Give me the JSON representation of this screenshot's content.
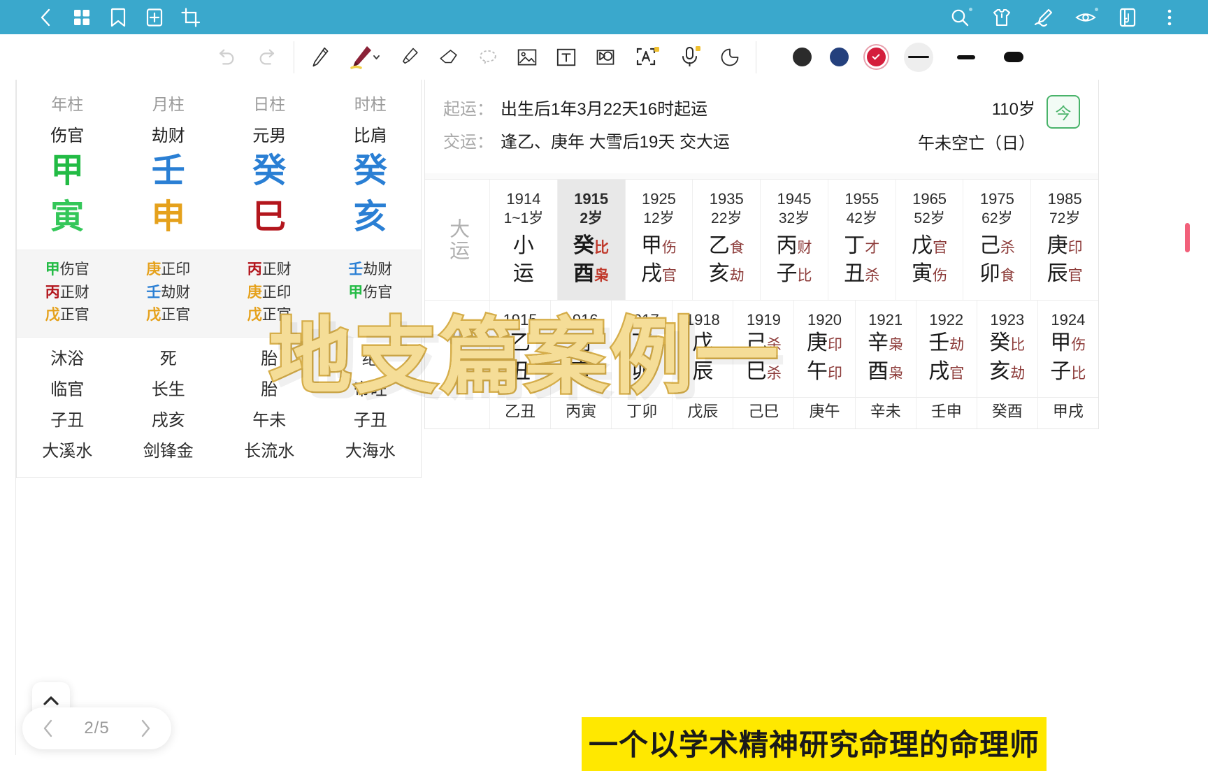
{
  "appbar": {
    "back": "back-arrow",
    "left_icons": [
      "grid-icon",
      "bookmark-icon",
      "add-page-icon",
      "crop-icon"
    ],
    "right_icons": [
      "search-icon",
      "shirt-icon",
      "sign-icon",
      "eye-icon",
      "book-icon",
      "more-icon"
    ]
  },
  "toolbar": {
    "undo": "undo-icon",
    "redo": "redo-icon",
    "tools": [
      "pen-icon",
      "fountain-pen-icon",
      "highlighter-icon",
      "eraser-icon",
      "lasso-icon",
      "image-icon",
      "text-icon",
      "shape-icon",
      "ocr-icon",
      "mic-icon",
      "sticker-icon"
    ],
    "colors": [
      {
        "name": "black",
        "hex": "#2b2b2b",
        "selected": false
      },
      {
        "name": "navy",
        "hex": "#24407d",
        "selected": false
      },
      {
        "name": "red",
        "hex": "#d41e3c",
        "selected": true
      }
    ],
    "strokes": [
      {
        "name": "thin",
        "selected": true
      },
      {
        "name": "medium",
        "selected": false
      },
      {
        "name": "thick",
        "selected": false
      }
    ]
  },
  "bazi": {
    "headers": [
      "年柱",
      "月柱",
      "日柱",
      "时柱"
    ],
    "ten_gods": [
      "伤官",
      "劫财",
      "元男",
      "比肩"
    ],
    "stems": [
      {
        "char": "甲",
        "color": "green"
      },
      {
        "char": "壬",
        "color": "blue"
      },
      {
        "char": "癸",
        "color": "blue"
      },
      {
        "char": "癸",
        "color": "blue"
      }
    ],
    "branches": [
      {
        "char": "寅",
        "color": "green"
      },
      {
        "char": "申",
        "color": "orange"
      },
      {
        "char": "巳",
        "color": "red"
      },
      {
        "char": "亥",
        "color": "blue"
      }
    ],
    "hidden_stems": [
      [
        {
          "s": "甲",
          "color": "green",
          "g": "伤官"
        },
        {
          "s": "丙",
          "color": "red",
          "g": "正财"
        },
        {
          "s": "戊",
          "color": "orange",
          "g": "正官"
        }
      ],
      [
        {
          "s": "庚",
          "color": "orange",
          "g": "正印"
        },
        {
          "s": "壬",
          "color": "blue",
          "g": "劫财"
        },
        {
          "s": "戊",
          "color": "orange",
          "g": "正官"
        }
      ],
      [
        {
          "s": "丙",
          "color": "red",
          "g": "正财"
        },
        {
          "s": "庚",
          "color": "orange",
          "g": "正印"
        },
        {
          "s": "戊",
          "color": "orange",
          "g": "正官"
        }
      ],
      [
        {
          "s": "壬",
          "color": "blue",
          "g": "劫财"
        },
        {
          "s": "甲",
          "color": "green",
          "g": "伤官"
        },
        {
          "s": "",
          "color": "orange",
          "g": ""
        }
      ]
    ],
    "changsheng": [
      "沐浴",
      "死",
      "胎",
      "绝"
    ],
    "changsheng2": [
      "临官",
      "长生",
      "胎",
      "帝旺"
    ],
    "kongwang": [
      "子丑",
      "戌亥",
      "午未",
      "子丑"
    ],
    "nayin": [
      "大溪水",
      "剑锋金",
      "长流水",
      "大海水"
    ]
  },
  "luck": {
    "qiyun_key": "起运：",
    "qiyun_val": "出生后1年3月22天16时起运",
    "jiaoyun_key": "交运：",
    "jiaoyun_val": "逢乙、庚年 大雪后19天 交大运",
    "age_total": "110岁",
    "kongwang": "午未空亡（日）",
    "today_label": "今",
    "dayun_label": "大运",
    "xiaoyun_label": "小运",
    "dayun": [
      {
        "year": "1914",
        "age": "1~1岁",
        "xiaoyun": true,
        "stem": "小",
        "stem_god": "",
        "branch": "运",
        "branch_god": "",
        "selected": false
      },
      {
        "year": "1915",
        "age": "2岁",
        "stem": "癸",
        "stem_god": "比",
        "branch": "酉",
        "branch_god": "枭",
        "selected": true
      },
      {
        "year": "1925",
        "age": "12岁",
        "stem": "甲",
        "stem_god": "伤",
        "branch": "戌",
        "branch_god": "官",
        "selected": false
      },
      {
        "year": "1935",
        "age": "22岁",
        "stem": "乙",
        "stem_god": "食",
        "branch": "亥",
        "branch_god": "劫",
        "selected": false
      },
      {
        "year": "1945",
        "age": "32岁",
        "stem": "丙",
        "stem_god": "财",
        "branch": "子",
        "branch_god": "比",
        "selected": false
      },
      {
        "year": "1955",
        "age": "42岁",
        "stem": "丁",
        "stem_god": "才",
        "branch": "丑",
        "branch_god": "杀",
        "selected": false
      },
      {
        "year": "1965",
        "age": "52岁",
        "stem": "戊",
        "stem_god": "官",
        "branch": "寅",
        "branch_god": "伤",
        "selected": false
      },
      {
        "year": "1975",
        "age": "62岁",
        "stem": "己",
        "stem_god": "杀",
        "branch": "卯",
        "branch_god": "食",
        "selected": false
      },
      {
        "year": "1985",
        "age": "72岁",
        "stem": "庚",
        "stem_god": "印",
        "branch": "辰",
        "branch_god": "官",
        "selected": false
      }
    ],
    "liunian": [
      {
        "year": "1915",
        "stem": "乙",
        "stem_god": "",
        "branch": "丑",
        "branch_god": ""
      },
      {
        "year": "1916",
        "stem": "丙",
        "stem_god": "",
        "branch": "寅",
        "branch_god": ""
      },
      {
        "year": "1917",
        "stem": "丁",
        "stem_god": "",
        "branch": "卯",
        "branch_god": ""
      },
      {
        "year": "1918",
        "stem": "戊",
        "stem_god": "",
        "branch": "辰",
        "branch_god": ""
      },
      {
        "year": "1919",
        "stem": "己",
        "stem_god": "杀",
        "branch": "巳",
        "branch_god": "杀"
      },
      {
        "year": "1920",
        "stem": "庚",
        "stem_god": "印",
        "branch": "午",
        "branch_god": "印"
      },
      {
        "year": "1921",
        "stem": "辛",
        "stem_god": "枭",
        "branch": "酉",
        "branch_god": "枭"
      },
      {
        "year": "1922",
        "stem": "壬",
        "stem_god": "劫",
        "branch": "戌",
        "branch_god": "官"
      },
      {
        "year": "1923",
        "stem": "癸",
        "stem_god": "比",
        "branch": "亥",
        "branch_god": "劫"
      },
      {
        "year": "1924",
        "stem": "甲",
        "stem_god": "伤",
        "branch": "子",
        "branch_god": "比"
      }
    ],
    "liunian_nayin": [
      "乙丑",
      "丙寅",
      "丁卯",
      "戊辰",
      "己巳",
      "庚午",
      "辛未",
      "壬申",
      "癸酉",
      "甲戌"
    ]
  },
  "sticker": {
    "text": "地支篇案例一"
  },
  "footer": {
    "page": "2/5",
    "prev": "prev-page",
    "next": "next-page",
    "collapse": "collapse-toolbar",
    "caption": "一个以学术精神研究命理的命理师"
  }
}
